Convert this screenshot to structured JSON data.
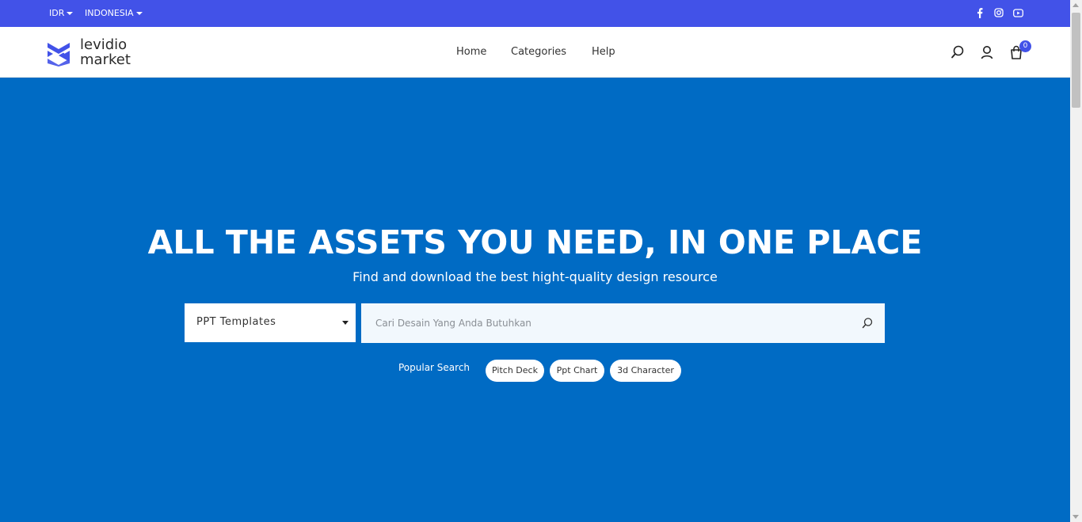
{
  "topbar": {
    "currency": "IDR",
    "region": "INDONESIA",
    "social": [
      "facebook-icon",
      "instagram-icon",
      "youtube-icon"
    ],
    "bg_color": "#4252e8"
  },
  "navbar": {
    "logo_line1": "levidio",
    "logo_line2": "market",
    "links": [
      "Home",
      "Categories",
      "Help"
    ],
    "cart_count": "0"
  },
  "hero": {
    "title": "ALL THE ASSETS YOU NEED, IN ONE PLACE",
    "subtitle": "Find and download the best hight-quality design resource",
    "bg_color": "#006bc4"
  },
  "search": {
    "category": "PPT Templates",
    "placeholder": "Cari Desain Yang Anda Butuhkan",
    "value": ""
  },
  "popular": {
    "label": "Popular Search",
    "tags": [
      "Pitch Deck",
      "Ppt Chart",
      "3d Character"
    ]
  }
}
